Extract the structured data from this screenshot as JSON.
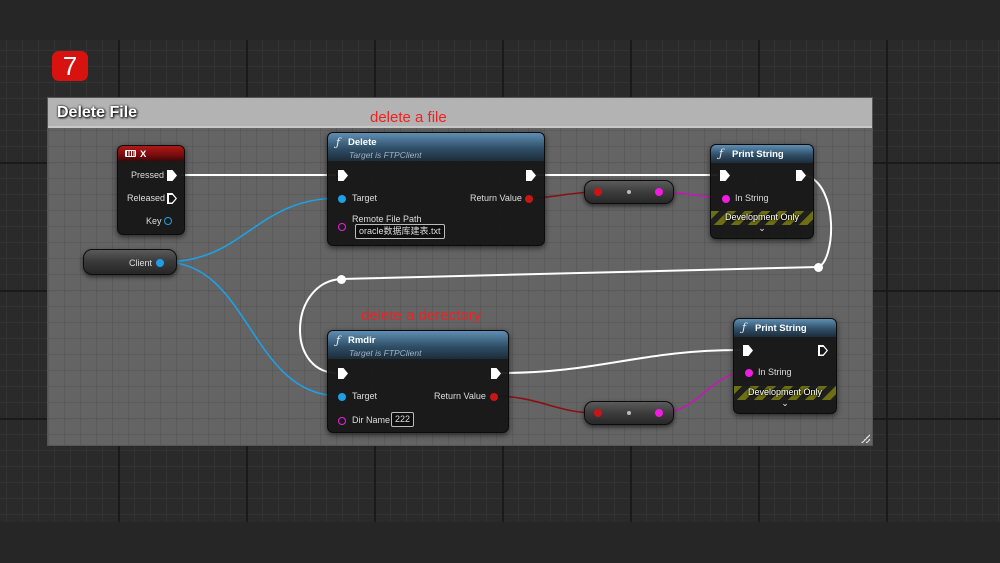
{
  "step_badge": "7",
  "comment": {
    "title": "Delete File"
  },
  "annotations": {
    "delete_file": "delete a file",
    "delete_directory": "delete a derectory"
  },
  "key_event": {
    "title": "X",
    "pressed": "Pressed",
    "released": "Released",
    "key": "Key"
  },
  "client_var": {
    "label": "Client"
  },
  "delete_node": {
    "title": "Delete",
    "subtitle": "Target is FTPClient",
    "target": "Target",
    "return_value": "Return Value",
    "remote_path_label": "Remote File Path",
    "remote_path_value": "oracle数据库建表.txt"
  },
  "rmdir_node": {
    "title": "Rmdir",
    "subtitle": "Target is FTPClient",
    "target": "Target",
    "return_value": "Return Value",
    "dir_name_label": "Dir Name",
    "dir_name_value": "222"
  },
  "print1": {
    "title": "Print String",
    "in_string": "In String",
    "dev_only": "Development Only",
    "chevron": "⌄"
  },
  "print2": {
    "title": "Print String",
    "in_string": "In String",
    "dev_only": "Development Only",
    "chevron": "⌄"
  },
  "icons": {
    "function": "ƒ",
    "keyboard": "keyboard-icon"
  },
  "colors": {
    "exec_wire": "#ffffff",
    "object_wire": "#1fa0e6",
    "string_pin": "#f01ce0",
    "bool_pin": "#c81616",
    "bool_wire": "#8a1010",
    "annotation": "#ee2222",
    "badge": "#d8130f"
  }
}
